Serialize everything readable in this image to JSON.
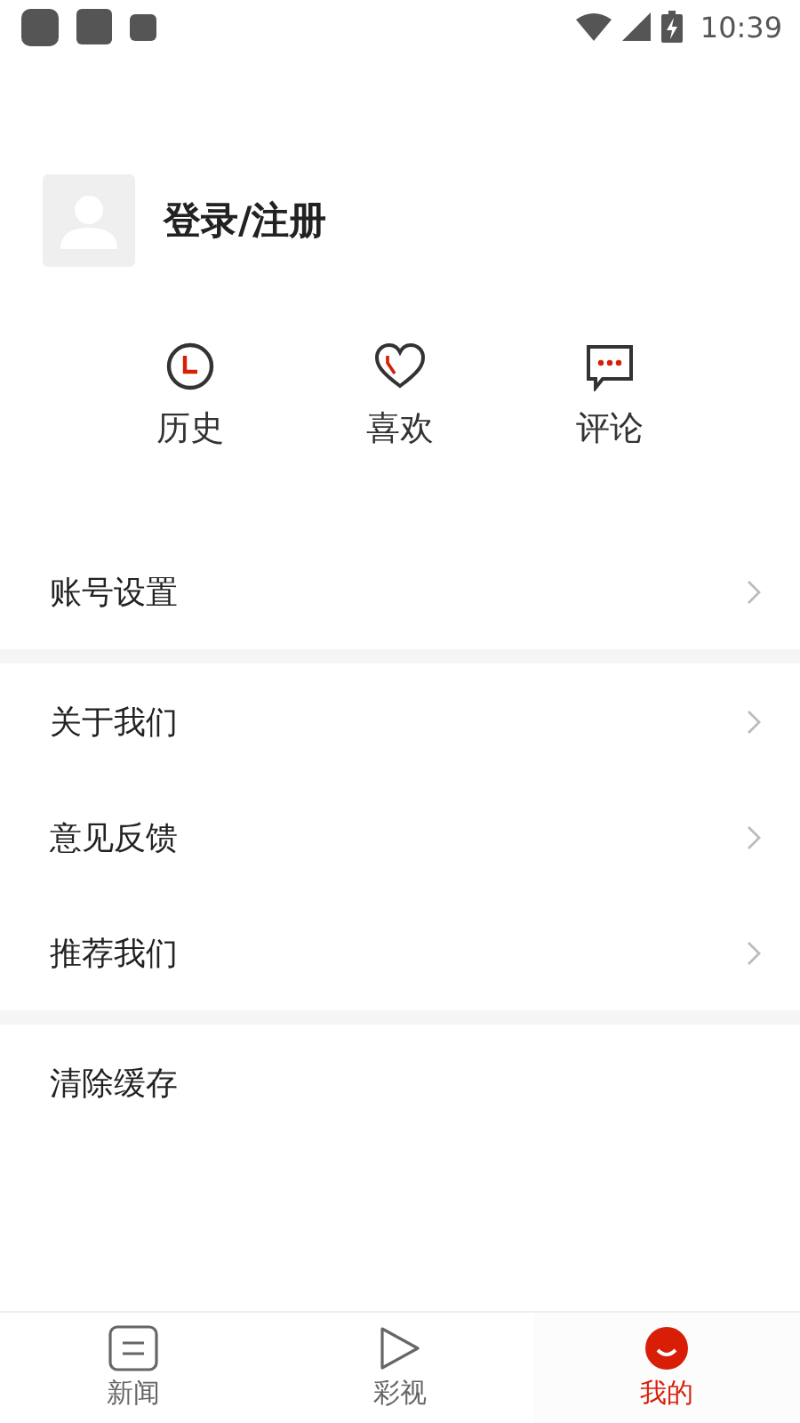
{
  "status_bar": {
    "time": "10:39"
  },
  "profile": {
    "login_label": "登录/注册"
  },
  "quick_actions": [
    {
      "kind": "history",
      "label": "历史"
    },
    {
      "kind": "like",
      "label": "喜欢"
    },
    {
      "kind": "comment",
      "label": "评论"
    }
  ],
  "menu_groups": [
    [
      {
        "kind": "link",
        "label": "账号设置"
      }
    ],
    [
      {
        "kind": "link",
        "label": "关于我们"
      },
      {
        "kind": "link",
        "label": "意见反馈"
      },
      {
        "kind": "link",
        "label": "推荐我们"
      }
    ],
    [
      {
        "kind": "action",
        "label": "清除缓存"
      }
    ]
  ],
  "bottom_nav": [
    {
      "kind": "news",
      "label": "新闻",
      "selected": false
    },
    {
      "kind": "video",
      "label": "彩视",
      "selected": false
    },
    {
      "kind": "me",
      "label": "我的",
      "selected": true
    }
  ]
}
